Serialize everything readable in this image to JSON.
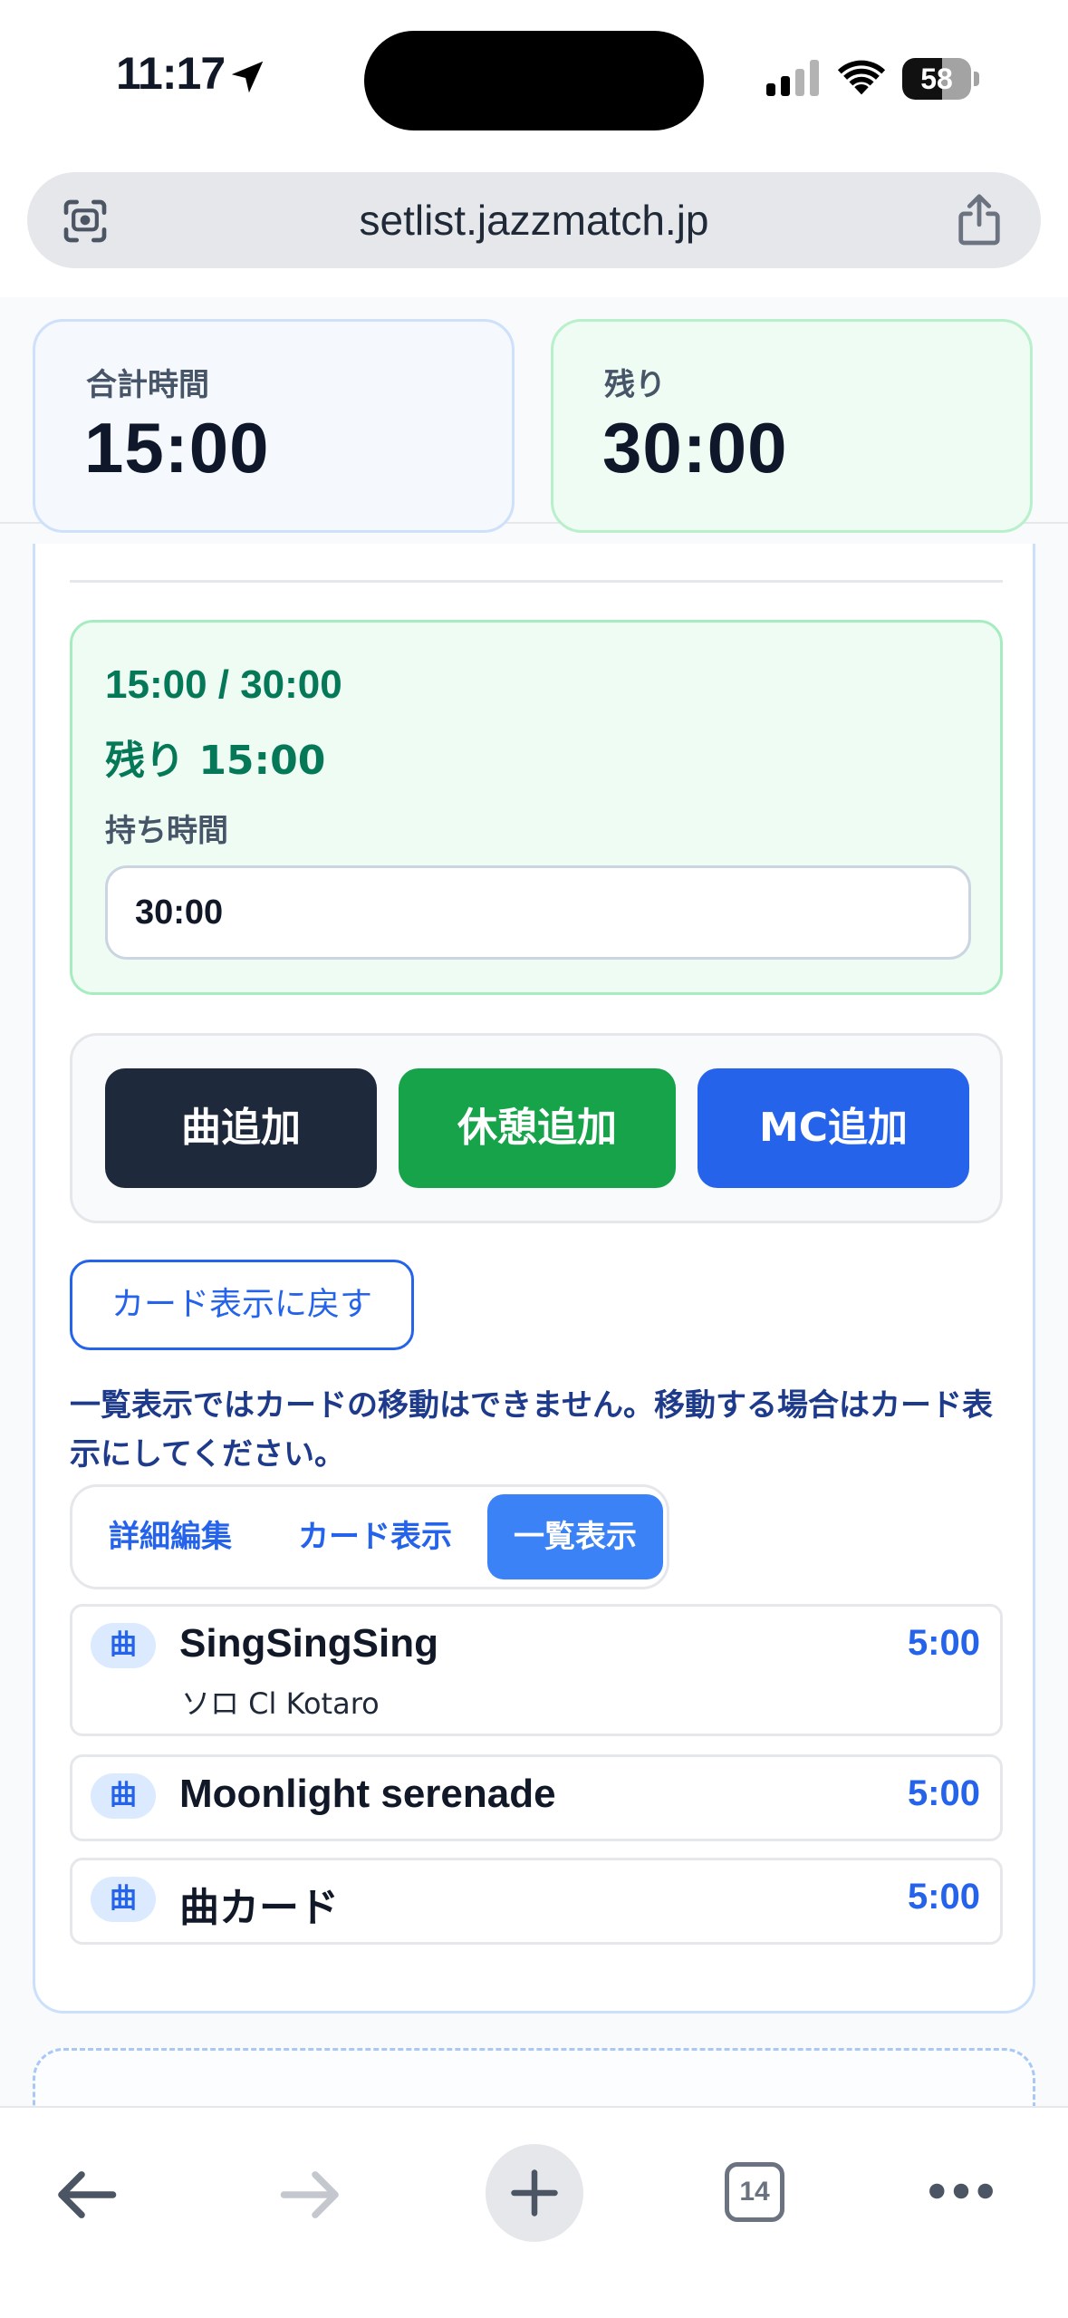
{
  "status_bar": {
    "time": "11:17",
    "battery": "58",
    "battery_level": 0.58,
    "icons": [
      "location-arrow-icon",
      "cellular-signal-icon",
      "wifi-icon",
      "battery-icon"
    ]
  },
  "browser": {
    "url": "setlist.jazzmatch.jp",
    "icons": [
      "scan-icon",
      "share-icon"
    ]
  },
  "summary": {
    "total_label": "合計時間",
    "total_value": "15:00",
    "remaining_label": "残り",
    "remaining_value": "30:00"
  },
  "time_panel": {
    "ratio": "15:00 / 30:00",
    "left": "残り 15:00",
    "label": "持ち時間",
    "input_value": "30:00"
  },
  "actions": {
    "add_song": "曲追加",
    "add_break": "休憩追加",
    "add_mc": "MC追加"
  },
  "back_to_cards": "カード表示に戻す",
  "notice": "一覧表示ではカードの移動はできません。移動する場合はカード表示にしてください。",
  "view_tabs": {
    "detail": "詳細編集",
    "card": "カード表示",
    "list": "一覧表示",
    "active": "list"
  },
  "setlist": [
    {
      "badge": "曲",
      "title": "SingSingSing",
      "subtitle": "ソロ Cl Kotaro",
      "time": "5:00"
    },
    {
      "badge": "曲",
      "title": "Moonlight serenade",
      "subtitle": "",
      "time": "5:00"
    },
    {
      "badge": "曲",
      "title": "曲カード",
      "subtitle": "",
      "time": "5:00"
    }
  ],
  "toolbar": {
    "tabs_count": "14",
    "icons": [
      "back-arrow-icon",
      "forward-arrow-icon",
      "plus-icon",
      "tabs-icon",
      "more-icon"
    ]
  },
  "colors": {
    "accent_blue": "#2563eb",
    "green": "#16a34a",
    "dark": "#1e293b",
    "success_text": "#047857"
  }
}
